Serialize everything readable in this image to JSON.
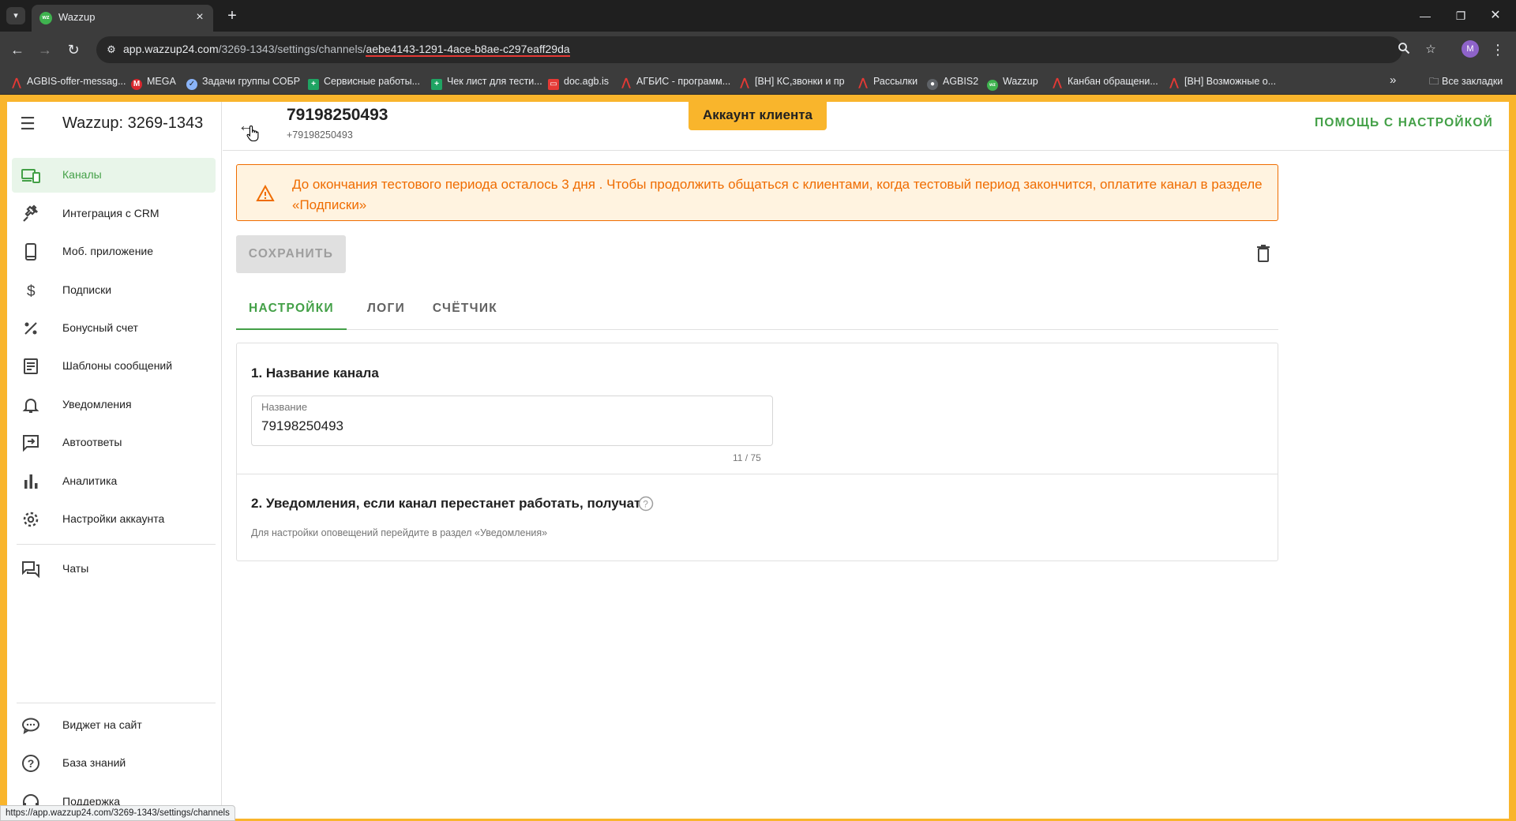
{
  "browser": {
    "tab_title": "Wazzup",
    "url_host": "app.wazzup24.com",
    "url_path": "/3269-1343/settings/channels/",
    "url_id": "aebe4143-1291-4ace-b8ae-c297eaff29da",
    "profile_initial": "M",
    "bookmarks": [
      "AGBIS-offer-messag...",
      "MEGA",
      "Задачи группы СОБР",
      "Сервисные работы...",
      "Чек лист для тести...",
      "doc.agb.is",
      "АГБИС - программ...",
      "[ВН] КС,звонки и пр",
      "Рассылки",
      "AGBIS2",
      "Wazzup",
      "Канбан обращени...",
      "[ВН] Возможные о..."
    ],
    "all_bookmarks": "Все закладки",
    "status_url": "https://app.wazzup24.com/3269-1343/settings/channels"
  },
  "sidebar": {
    "title": "Wazzup: 3269-1343",
    "items": [
      {
        "label": "Каналы"
      },
      {
        "label": "Интеграция с CRM"
      },
      {
        "label": "Моб. приложение"
      },
      {
        "label": "Подписки"
      },
      {
        "label": "Бонусный счет"
      },
      {
        "label": "Шаблоны сообщений"
      },
      {
        "label": "Уведомления"
      },
      {
        "label": "Автоответы"
      },
      {
        "label": "Аналитика"
      },
      {
        "label": "Настройки аккаунта"
      },
      {
        "label": "Чаты"
      }
    ],
    "bottom_items": [
      {
        "label": "Виджет на сайт"
      },
      {
        "label": "База знаний"
      },
      {
        "label": "Поддержка"
      }
    ]
  },
  "header": {
    "title": "79198250493",
    "subtitle": "+79198250493",
    "client_badge": "Аккаунт клиента",
    "help_link": "ПОМОЩЬ С НАСТРОЙКОЙ"
  },
  "alert": {
    "text": "До окончания тестового периода осталось 3 дня . Чтобы продолжить общаться с клиентами, когда тестовый период закончится, оплатите канал в разделе «Подписки»"
  },
  "actions": {
    "save_label": "СОХРАНИТЬ"
  },
  "tabs": [
    {
      "label": "НАСТРОЙКИ"
    },
    {
      "label": "ЛОГИ"
    },
    {
      "label": "СЧЁТЧИК"
    }
  ],
  "settings": {
    "section1_title": "1. Название канала",
    "name_label": "Название",
    "name_value": "79198250493",
    "name_counter": "11 / 75",
    "section2_title": "2. Уведомления, если канал перестанет работать, получат",
    "section2_note": "Для настройки оповещений перейдите в раздел «Уведомления»"
  },
  "colors": {
    "accent": "#43a047",
    "frame": "#f9b52c",
    "warning": "#ef6c00"
  }
}
